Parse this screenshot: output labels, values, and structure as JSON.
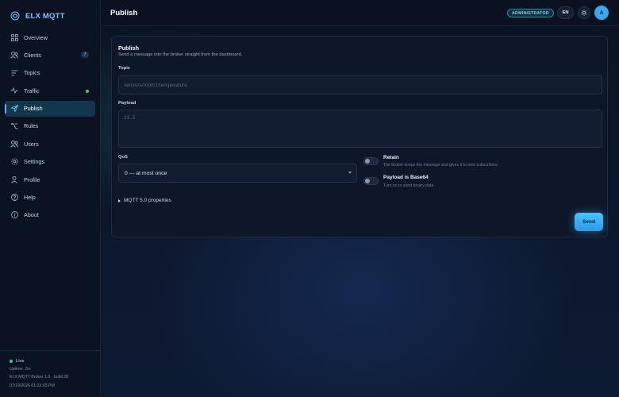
{
  "app": {
    "name": "ELX MQTT",
    "accent": "#7cc7ff"
  },
  "sidebar": {
    "items": [
      {
        "label": "Overview",
        "icon": "grid-icon"
      },
      {
        "label": "Clients",
        "icon": "users-icon",
        "badge": "7"
      },
      {
        "label": "Topics",
        "icon": "lines-icon"
      },
      {
        "label": "Traffic",
        "icon": "activity-icon",
        "status": "green-dot"
      },
      {
        "label": "Publish",
        "icon": "send-icon",
        "active": true
      },
      {
        "label": "Rules",
        "icon": "branch-icon"
      },
      {
        "label": "Users",
        "icon": "users-icon"
      },
      {
        "label": "Settings",
        "icon": "gear-icon"
      },
      {
        "label": "Profile",
        "icon": "user-icon"
      },
      {
        "label": "Help",
        "icon": "help-circle-icon"
      },
      {
        "label": "About",
        "icon": "info-circle-icon"
      }
    ],
    "footer": {
      "status": "Live",
      "uptime": "Uptime: 2m",
      "version": "ELX MQTT Broker 1.0 · build 28",
      "timestamp": "07/19/2026 01:22:03 PM"
    }
  },
  "topbar": {
    "title": "Publish",
    "role": "ADMINISTRATOR",
    "language": "EN",
    "avatar_initial": "A"
  },
  "publish": {
    "title": "Publish",
    "subtitle": "Send a message into the broker straight from the dashboard.",
    "topic_label": "Topic",
    "topic_placeholder": "sensors/room1/temperature",
    "payload_label": "Payload",
    "payload_placeholder": "23.5",
    "qos_label": "QoS",
    "qos_value": "0 — at most once",
    "retain_title": "Retain",
    "retain_desc": "The broker keeps the message and gives it to new subscribers",
    "retain_on": false,
    "base64_title": "Payload is Base64",
    "base64_desc": "Turn on to send binary data",
    "base64_on": false,
    "mqtt5_label": "MQTT 5.0 properties",
    "send_label": "Send"
  }
}
